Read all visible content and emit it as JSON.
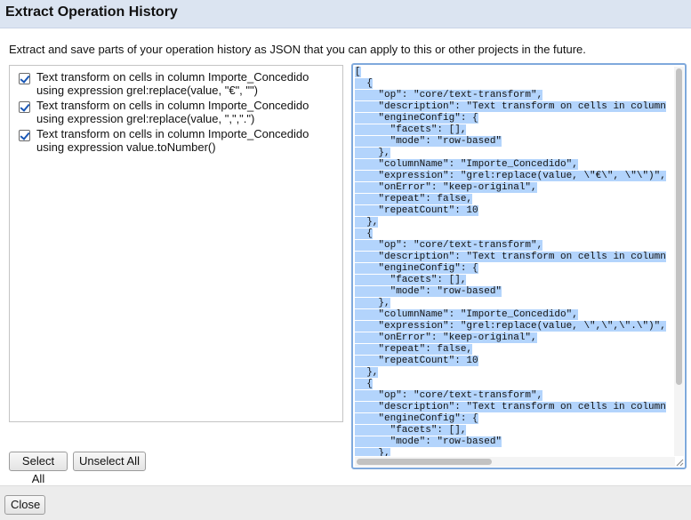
{
  "dialog": {
    "title": "Extract Operation History",
    "description": "Extract and save parts of your operation history as JSON that you can apply to this or other projects in the future."
  },
  "operations": [
    {
      "label": "Text transform on cells in column Importe_Concedido\nusing expression grel:replace(value, \"€\", \"\")",
      "checked": true
    },
    {
      "label": "Text transform on cells in column Importe_Concedido\nusing expression grel:replace(value, \",\",\".\")",
      "checked": true
    },
    {
      "label": "Text transform on cells in column Importe_Concedido\nusing expression value.toNumber()",
      "checked": true
    }
  ],
  "json_lines": [
    "[",
    "  {",
    "    \"op\": \"core/text-transform\",",
    "    \"description\": \"Text transform on cells in column",
    "    \"engineConfig\": {",
    "      \"facets\": [],",
    "      \"mode\": \"row-based\"",
    "    },",
    "    \"columnName\": \"Importe_Concedido\",",
    "    \"expression\": \"grel:replace(value, \\\"€\\\", \\\"\\\")\",",
    "    \"onError\": \"keep-original\",",
    "    \"repeat\": false,",
    "    \"repeatCount\": 10",
    "  },",
    "  {",
    "    \"op\": \"core/text-transform\",",
    "    \"description\": \"Text transform on cells in column",
    "    \"engineConfig\": {",
    "      \"facets\": [],",
    "      \"mode\": \"row-based\"",
    "    },",
    "    \"columnName\": \"Importe_Concedido\",",
    "    \"expression\": \"grel:replace(value, \\\",\\\",\\\".\\\")\",",
    "    \"onError\": \"keep-original\",",
    "    \"repeat\": false,",
    "    \"repeatCount\": 10",
    "  },",
    "  {",
    "    \"op\": \"core/text-transform\",",
    "    \"description\": \"Text transform on cells in column",
    "    \"engineConfig\": {",
    "      \"facets\": [],",
    "      \"mode\": \"row-based\"",
    "    },"
  ],
  "buttons": {
    "select_all": "Select All",
    "unselect_all": "Unselect All",
    "close": "Close"
  },
  "colors": {
    "header_bg": "#dbe4f1",
    "selection": "#b3d4fc",
    "focus_border": "#7fa9dc",
    "footer_bg": "#ececec"
  }
}
